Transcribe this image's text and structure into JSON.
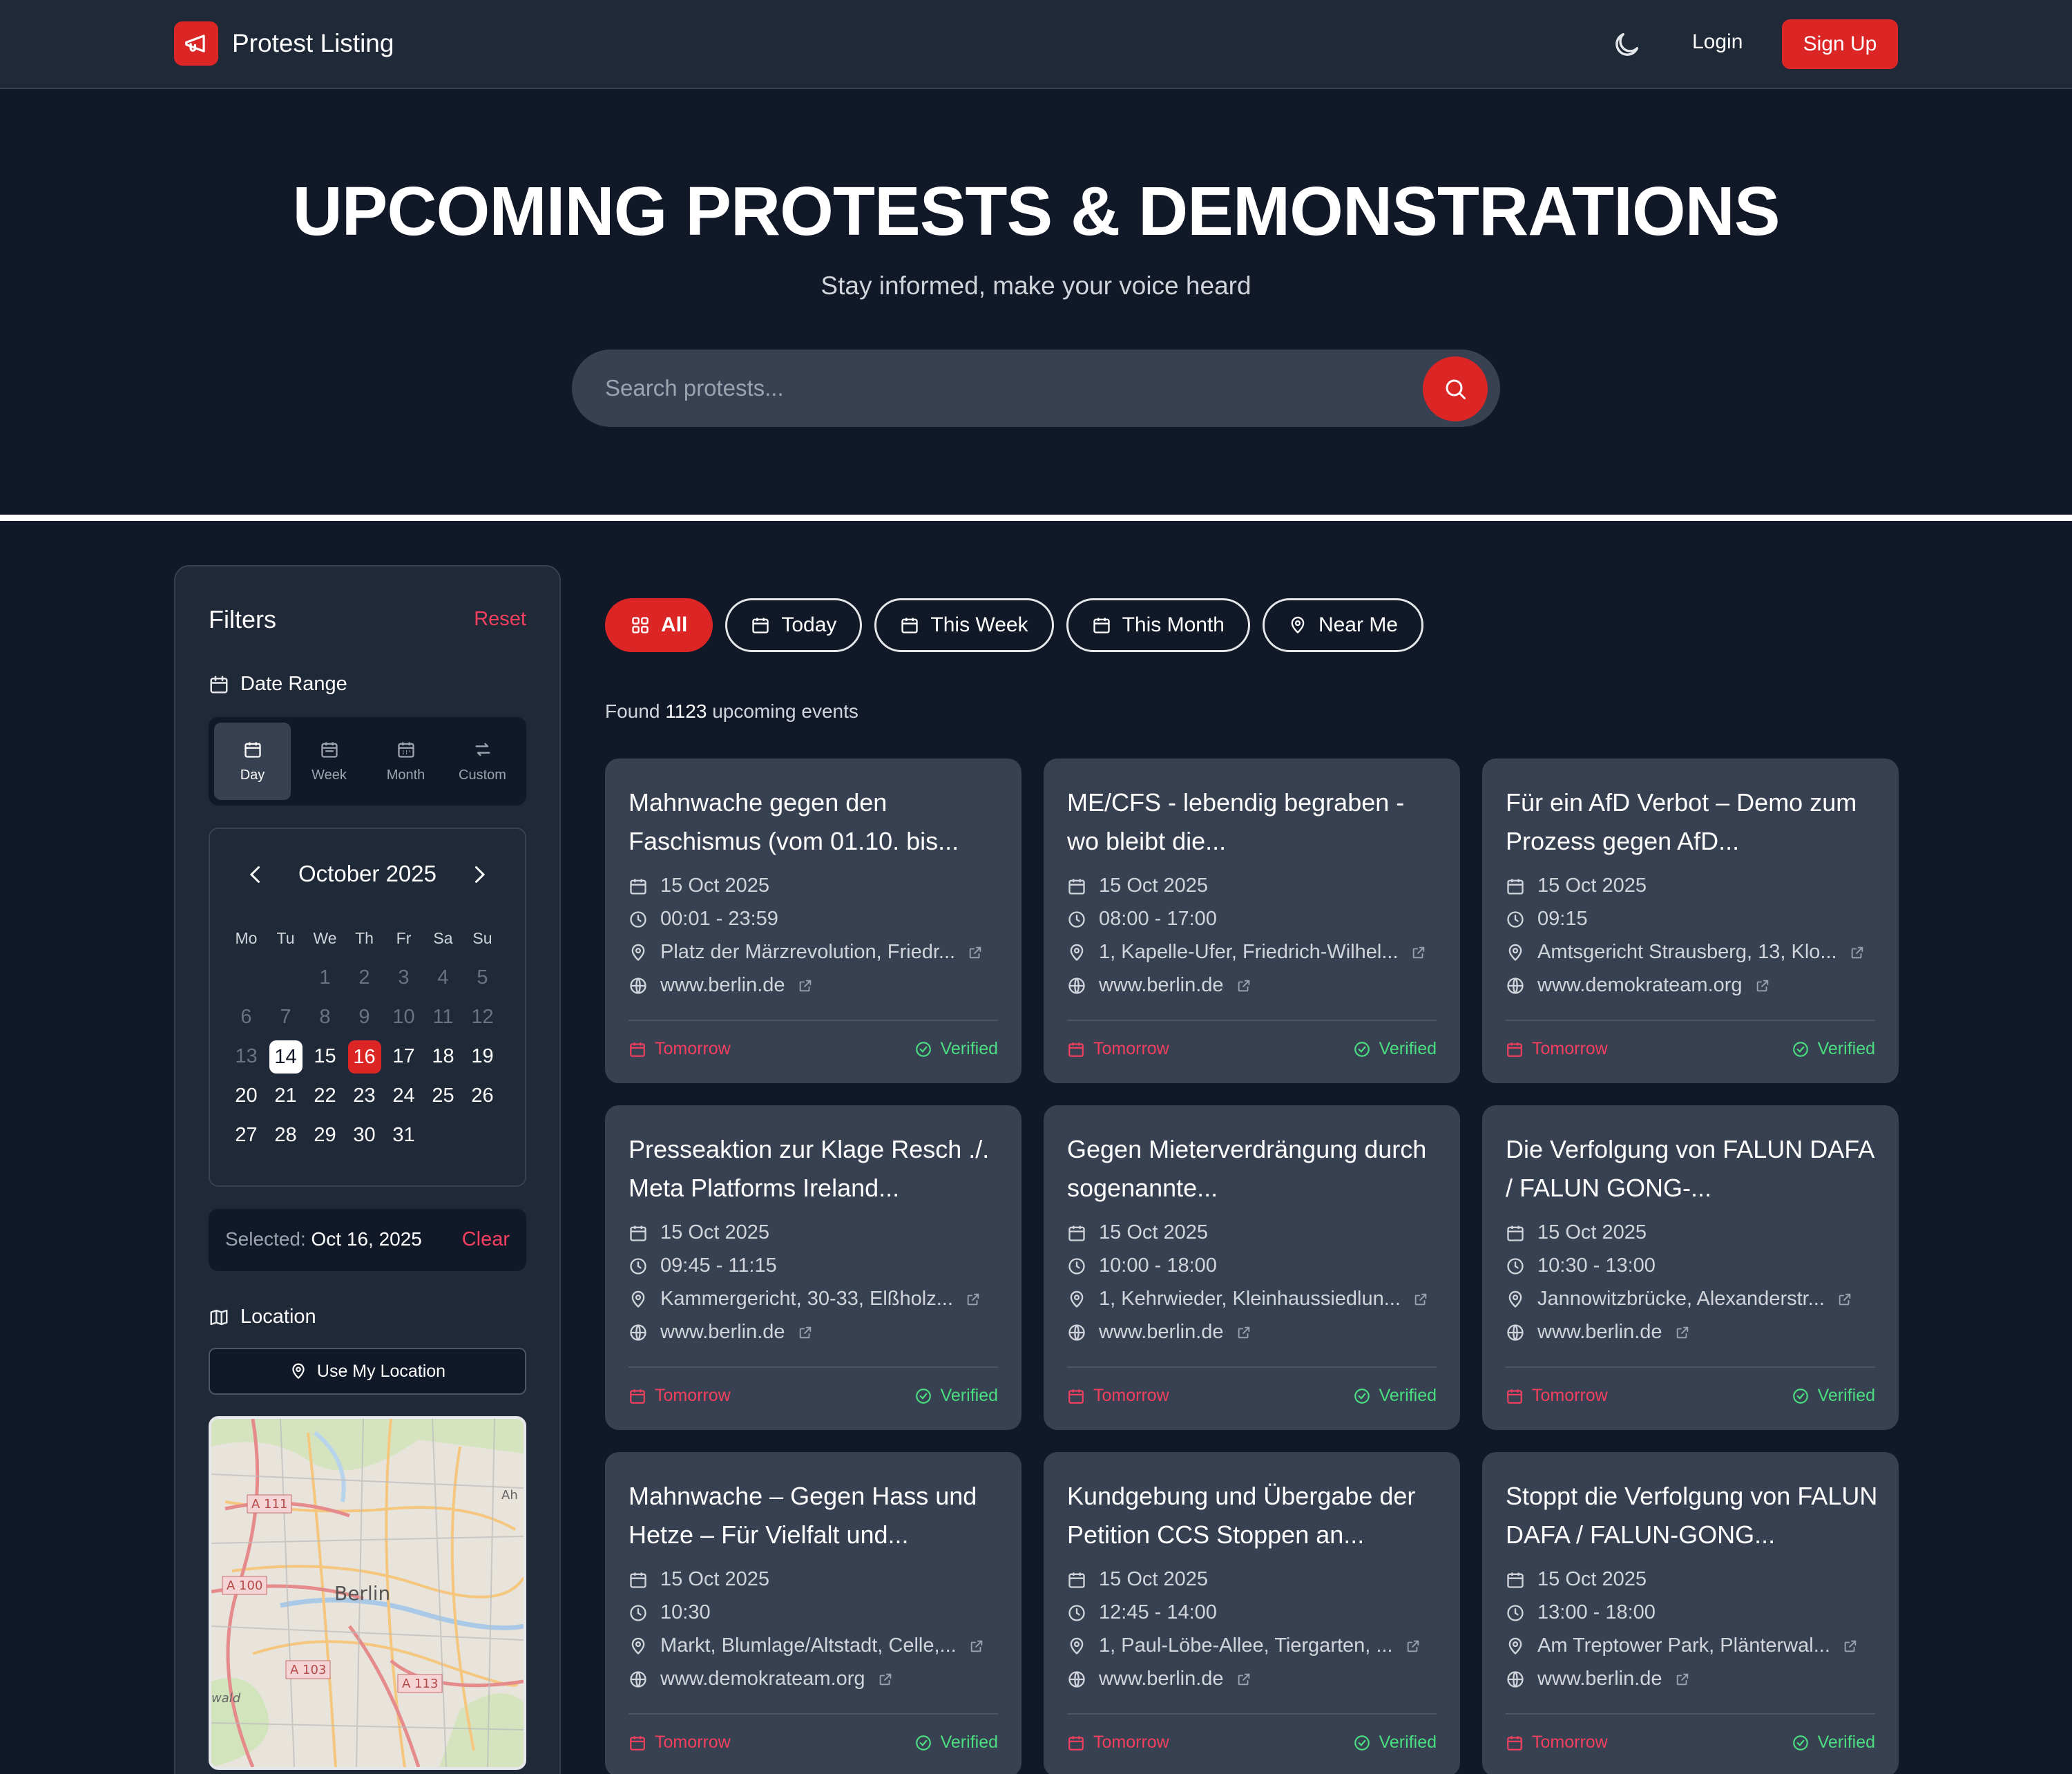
{
  "nav": {
    "brand": "Protest Listing",
    "login": "Login",
    "signup": "Sign Up"
  },
  "hero": {
    "title": "UPCOMING PROTESTS & DEMONSTRATIONS",
    "subtitle": "Stay informed, make your voice heard",
    "search_placeholder": "Search protests..."
  },
  "sidebar": {
    "title": "Filters",
    "reset": "Reset",
    "date_range_label": "Date Range",
    "date_tabs": [
      "Day",
      "Week",
      "Month",
      "Custom"
    ],
    "calendar": {
      "month": "October 2025",
      "weekdays": [
        "Mo",
        "Tu",
        "We",
        "Th",
        "Fr",
        "Sa",
        "Su"
      ],
      "today": "14",
      "selected": "16"
    },
    "selected_label": "Selected:",
    "selected_value": "Oct 16, 2025",
    "clear": "Clear",
    "location_label": "Location",
    "use_location": "Use My Location",
    "map_labels": {
      "a111": "A 111",
      "a100": "A 100",
      "a103": "A 103",
      "a113": "A 113",
      "city": "Berlin",
      "edge_right": "Ah",
      "edge_left": "wald"
    }
  },
  "filters": {
    "pills": [
      "All",
      "Today",
      "This Week",
      "This Month",
      "Near Me"
    ]
  },
  "results": {
    "found_prefix": "Found",
    "count": "1123",
    "found_suffix": "upcoming events"
  },
  "cards": [
    {
      "title": "Mahnwache gegen den Faschismus (vom 01.10. bis...",
      "date": "15 Oct 2025",
      "time": "00:01 - 23:59",
      "location": "Platz der Märzrevolution, Friedr...",
      "website": "www.berlin.de",
      "when": "Tomorrow",
      "status": "Verified"
    },
    {
      "title": "ME/CFS - lebendig begraben - wo bleibt die...",
      "date": "15 Oct 2025",
      "time": "08:00 - 17:00",
      "location": "1, Kapelle-Ufer, Friedrich-Wilhel...",
      "website": "www.berlin.de",
      "when": "Tomorrow",
      "status": "Verified"
    },
    {
      "title": "Für ein AfD Verbot – Demo zum Prozess gegen AfD...",
      "date": "15 Oct 2025",
      "time": "09:15",
      "location": "Amtsgericht Strausberg, 13, Klo...",
      "website": "www.demokrateam.org",
      "when": "Tomorrow",
      "status": "Verified"
    },
    {
      "title": "Presseaktion zur Klage Resch ./. Meta Platforms Ireland...",
      "date": "15 Oct 2025",
      "time": "09:45 - 11:15",
      "location": "Kammergericht, 30-33, Elßholz...",
      "website": "www.berlin.de",
      "when": "Tomorrow",
      "status": "Verified"
    },
    {
      "title": "Gegen Mieterverdrängung durch sogenannte...",
      "date": "15 Oct 2025",
      "time": "10:00 - 18:00",
      "location": "1, Kehrwieder, Kleinhaussiedlun...",
      "website": "www.berlin.de",
      "when": "Tomorrow",
      "status": "Verified"
    },
    {
      "title": "Die Verfolgung von FALUN DAFA / FALUN GONG-...",
      "date": "15 Oct 2025",
      "time": "10:30 - 13:00",
      "location": "Jannowitzbrücke, Alexanderstr...",
      "website": "www.berlin.de",
      "when": "Tomorrow",
      "status": "Verified"
    },
    {
      "title": "Mahnwache – Gegen Hass und Hetze – Für Vielfalt und...",
      "date": "15 Oct 2025",
      "time": "10:30",
      "location": "Markt, Blumlage/Altstadt, Celle,...",
      "website": "www.demokrateam.org",
      "when": "Tomorrow",
      "status": "Verified"
    },
    {
      "title": "Kundgebung und Übergabe der Petition CCS Stoppen an...",
      "date": "15 Oct 2025",
      "time": "12:45 - 14:00",
      "location": "1, Paul-Löbe-Allee, Tiergarten, ...",
      "website": "www.berlin.de",
      "when": "Tomorrow",
      "status": "Verified"
    },
    {
      "title": "Stoppt die Verfolgung von FALUN DAFA / FALUN-GONG...",
      "date": "15 Oct 2025",
      "time": "13:00 - 18:00",
      "location": "Am Treptower Park, Plänterwal...",
      "website": "www.berlin.de",
      "when": "Tomorrow",
      "status": "Verified"
    }
  ],
  "colors": {
    "accent": "#dc2626",
    "link": "#f43f5e",
    "verified": "#4ade80",
    "background": "#111827",
    "surface": "#1f2937",
    "card": "#374151"
  },
  "icons": {
    "brand": "megaphone-icon",
    "theme": "moon-icon",
    "search": "search-icon",
    "calendar": "calendar-icon",
    "clock": "clock-icon",
    "location": "map-pin-icon",
    "website": "globe-icon",
    "external": "external-link-icon",
    "verified": "check-circle-icon"
  }
}
